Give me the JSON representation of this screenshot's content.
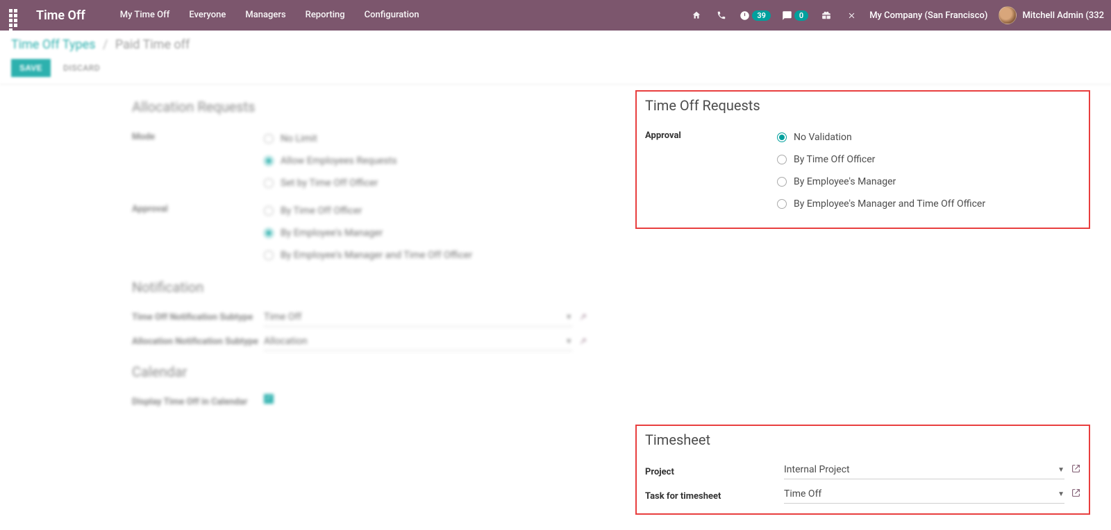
{
  "navbar": {
    "title": "Time Off",
    "menu": [
      "My Time Off",
      "Everyone",
      "Managers",
      "Reporting",
      "Configuration"
    ],
    "activity_badge": "39",
    "msg_badge": "0",
    "company": "My Company (San Francisco)",
    "user": "Mitchell Admin (332"
  },
  "breadcrumb": {
    "parent": "Time Off Types",
    "current": "Paid Time off"
  },
  "actions": {
    "save": "SAVE",
    "discard": "DISCARD"
  },
  "left": {
    "allocation_requests": {
      "title": "Allocation Requests",
      "mode_label": "Mode",
      "mode_options": [
        "No Limit",
        "Allow Employees Requests",
        "Set by Time Off Officer"
      ],
      "mode_selected": 1,
      "approval_label": "Approval",
      "approval_options": [
        "By Time Off Officer",
        "By Employee's Manager",
        "By Employee's Manager and Time Off Officer"
      ],
      "approval_selected": 1
    },
    "notification": {
      "title": "Notification",
      "sub1_label": "Time Off Notification Subtype",
      "sub1_value": "Time Off",
      "sub2_label": "Allocation Notification Subtype",
      "sub2_value": "Allocation"
    },
    "calendar": {
      "title": "Calendar",
      "display_label": "Display Time Off in Calendar"
    }
  },
  "right": {
    "timeoff_requests": {
      "title": "Time Off Requests",
      "approval_label": "Approval",
      "options": [
        "No Validation",
        "By Time Off Officer",
        "By Employee's Manager",
        "By Employee's Manager and Time Off Officer"
      ],
      "selected": 0
    },
    "timesheet": {
      "title": "Timesheet",
      "project_label": "Project",
      "project_value": "Internal Project",
      "task_label": "Task for timesheet",
      "task_value": "Time Off"
    }
  }
}
